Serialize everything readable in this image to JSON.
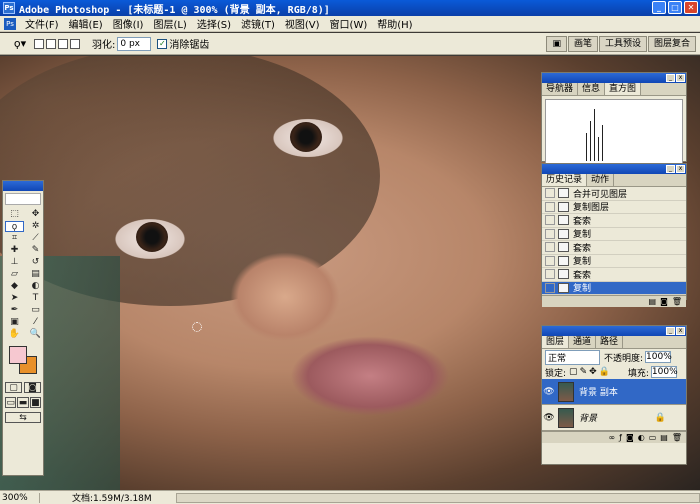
{
  "titlebar": {
    "icon": "Ps",
    "title": "Adobe Photoshop - [未标题-1 @ 300% (背景 副本, RGB/8)]",
    "min": "_",
    "max": "□",
    "close": "✕"
  },
  "menu": {
    "icon": "Ps",
    "items": [
      "文件(F)",
      "编辑(E)",
      "图像(I)",
      "图层(L)",
      "选择(S)",
      "滤镜(T)",
      "视图(V)",
      "窗口(W)",
      "帮助(H)"
    ]
  },
  "options": {
    "tool_icon": "lasso-icon",
    "feather_label": "羽化:",
    "feather_value": "0 px",
    "antialias_label": "消除锯齿",
    "antialias_checked": true,
    "wells": [
      "画笔",
      "工具预设",
      "图层复合"
    ]
  },
  "navigator": {
    "tabs": [
      "导航器",
      "信息",
      "直方图"
    ],
    "active_tab": 2
  },
  "history": {
    "tabs": [
      "历史记录",
      "动作"
    ],
    "items": [
      {
        "label": "合并可见图层",
        "icon": "doc-icon"
      },
      {
        "label": "复制图层",
        "icon": "doc-icon"
      },
      {
        "label": "套索",
        "icon": "lasso-icon"
      },
      {
        "label": "复制",
        "icon": "doc-icon"
      },
      {
        "label": "套索",
        "icon": "lasso-icon"
      },
      {
        "label": "复制",
        "icon": "doc-icon"
      },
      {
        "label": "套索",
        "icon": "lasso-icon"
      },
      {
        "label": "复制",
        "icon": "doc-icon",
        "selected": true
      }
    ]
  },
  "layers": {
    "tabs": [
      "图层",
      "通道",
      "路径"
    ],
    "blend_mode": "正常",
    "opacity_label": "不透明度:",
    "opacity_value": "100%",
    "lock_label": "锁定:",
    "fill_label": "填充:",
    "fill_value": "100%",
    "items": [
      {
        "name": "背景 副本",
        "selected": true
      },
      {
        "name": "背景",
        "locked": true
      }
    ]
  },
  "status": {
    "zoom": "300%",
    "doc": "文档:1.59M/3.18M"
  },
  "colors": {
    "accent": "#3168c6",
    "foreground": "#f6c8d0",
    "background": "#e8902a"
  }
}
